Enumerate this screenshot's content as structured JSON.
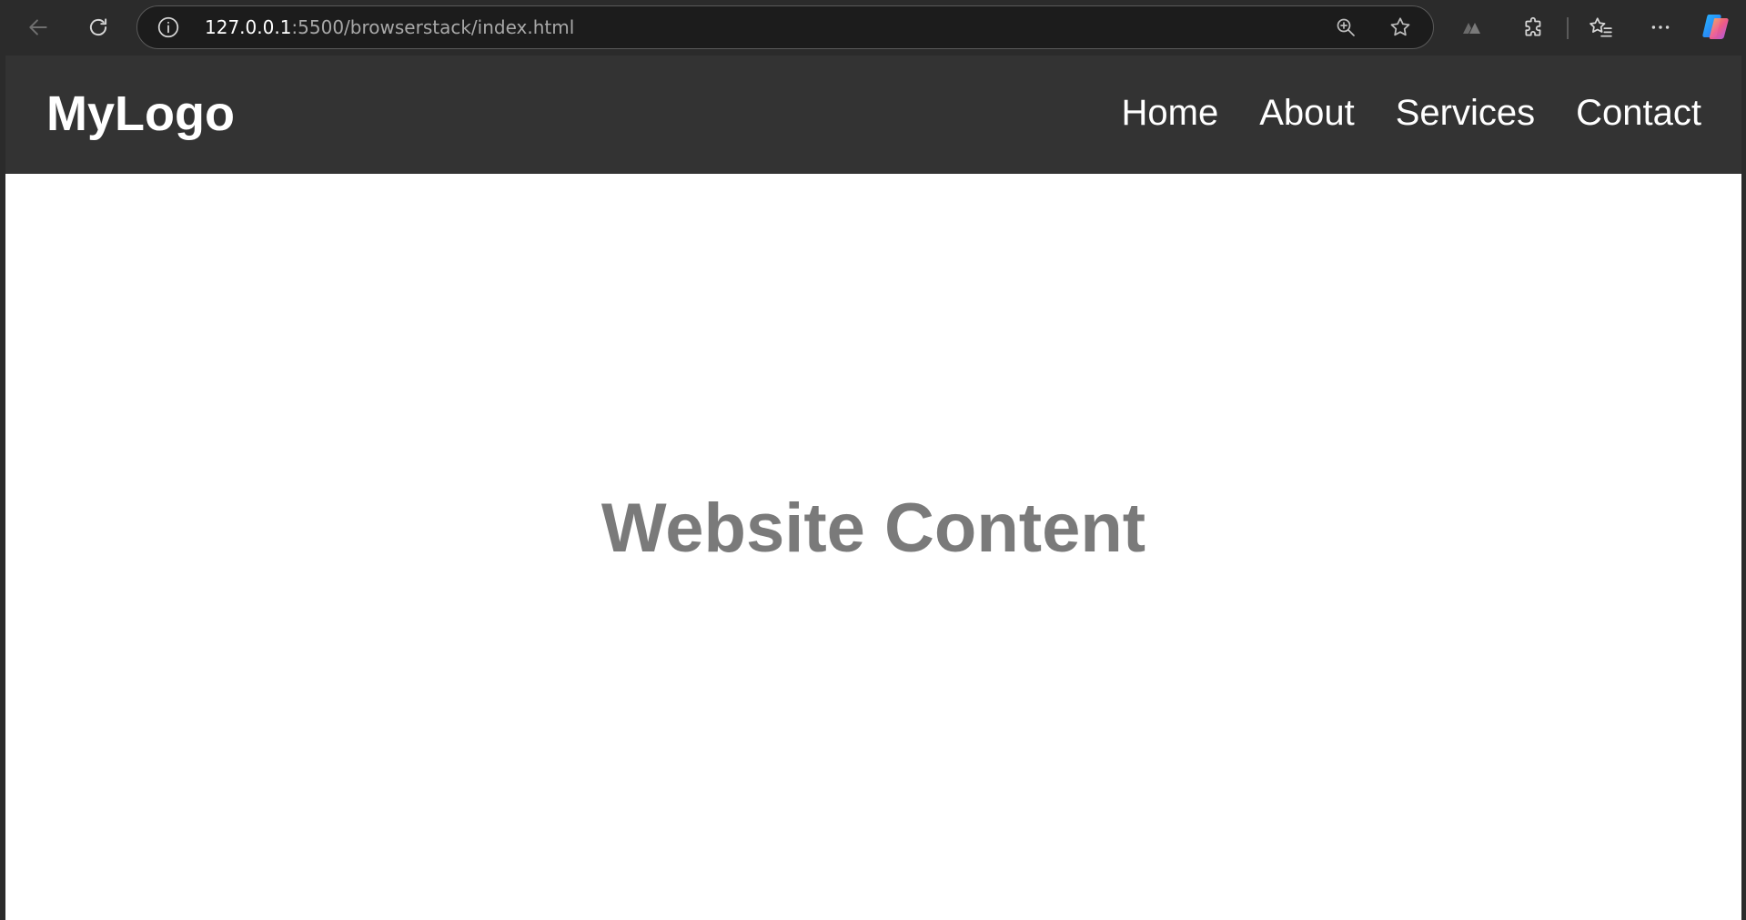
{
  "browser": {
    "url_host": "127.0.0.1",
    "url_path": ":5500/browserstack/index.html",
    "icons": {
      "back": "arrow-left-icon",
      "refresh": "refresh-icon",
      "site_info": "info-icon",
      "zoom": "zoom-in-icon",
      "favorite": "star-icon",
      "read_aloud": "read-aloud-icon",
      "extensions": "puzzle-icon",
      "favorites": "favorites-list-icon",
      "more": "more-dots-icon",
      "copilot": "copilot-icon"
    }
  },
  "site": {
    "logo": "MyLogo",
    "nav": {
      "home": "Home",
      "about": "About",
      "services": "Services",
      "contact": "Contact"
    },
    "heading": "Website Content"
  },
  "colors": {
    "browser_chrome": "#2b2b2b",
    "header_bg": "#333333",
    "heading_text": "#7a7a7a",
    "page_bg": "#ffffff"
  }
}
